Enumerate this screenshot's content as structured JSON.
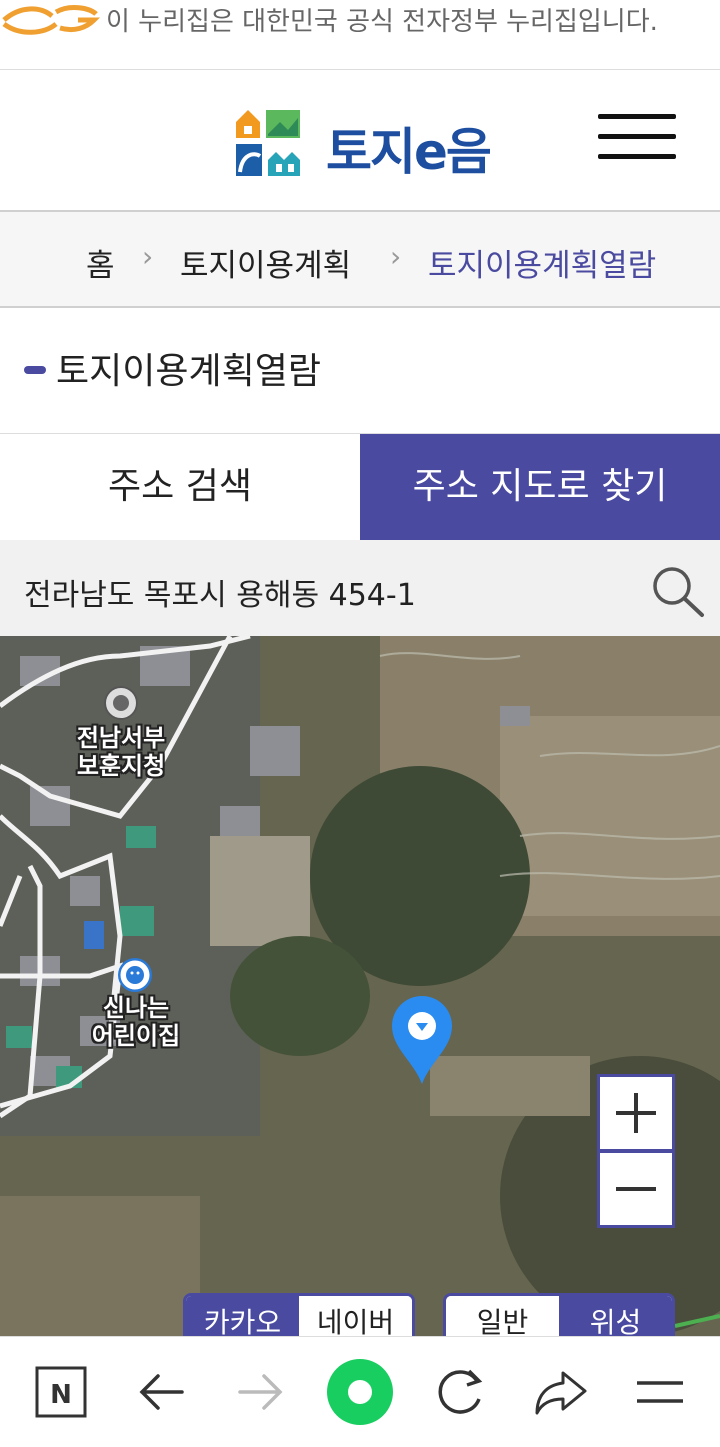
{
  "gov_banner": {
    "text": "이 누리집은 대한민국 공식 전자정부 누리집입니다."
  },
  "header": {
    "logo_text": "토지e음"
  },
  "breadcrumb": {
    "items": [
      "홈",
      "토지이용계획",
      "토지이용계획열람"
    ]
  },
  "page": {
    "title": "토지이용계획열람"
  },
  "tabs": [
    {
      "label": "주소 검색"
    },
    {
      "label": "주소 지도로 찾기"
    }
  ],
  "address": {
    "value": "전라남도 목포시 용해동 454-1"
  },
  "map": {
    "labels": [
      {
        "text": "전남서부\n보훈지청"
      },
      {
        "text": "신나는\n어린이집"
      }
    ],
    "provider": {
      "options": [
        "카카오",
        "네이버"
      ],
      "selected": "카카오"
    },
    "type": {
      "options": [
        "일반",
        "위성"
      ],
      "selected": "위성"
    },
    "zoom_in": "+",
    "zoom_out": "−"
  },
  "colors": {
    "accent": "#4a4ba0",
    "logo_blue": "#1d4ea0"
  },
  "browser_bar": {
    "icons": [
      "naver-n-icon",
      "back-arrow-icon",
      "forward-arrow-icon",
      "home-green-icon",
      "refresh-icon",
      "share-icon",
      "menu-icon"
    ]
  }
}
